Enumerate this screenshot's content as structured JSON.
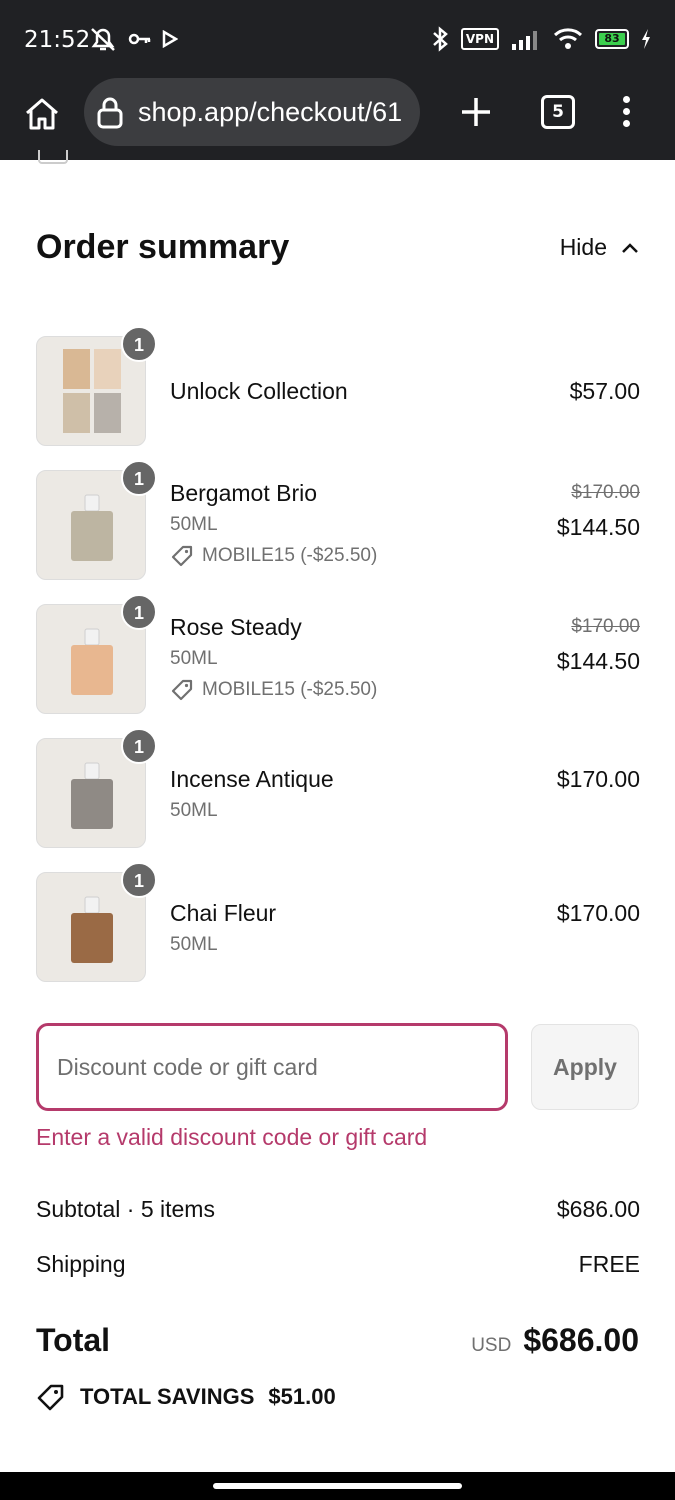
{
  "status_bar": {
    "time": "21:52",
    "vpn": "VPN",
    "battery": "83",
    "battery_color": "#3ccf4e"
  },
  "browser": {
    "url": "shop.app/checkout/61",
    "tab_count": "5"
  },
  "order_summary": {
    "title": "Order summary",
    "toggle_label": "Hide"
  },
  "items": [
    {
      "name": "Unlock Collection",
      "qty": "1",
      "price": "$57.00",
      "thumb_color": "#d8c3a8"
    },
    {
      "name": "Bergamot Brio",
      "qty": "1",
      "variant": "50ML",
      "discount_code": "MOBILE15 (-$25.50)",
      "old_price": "$170.00",
      "price": "$144.50",
      "thumb_color": "#bdb5a2"
    },
    {
      "name": "Rose Steady",
      "qty": "1",
      "variant": "50ML",
      "discount_code": "MOBILE15 (-$25.50)",
      "old_price": "$170.00",
      "price": "$144.50",
      "thumb_color": "#e8b790"
    },
    {
      "name": "Incense Antique",
      "qty": "1",
      "variant": "50ML",
      "price": "$170.00",
      "thumb_color": "#8f8a85"
    },
    {
      "name": "Chai Fleur",
      "qty": "1",
      "variant": "50ML",
      "price": "$170.00",
      "thumb_color": "#9a6a45"
    }
  ],
  "discount": {
    "placeholder": "Discount code or gift card",
    "apply_label": "Apply",
    "error": "Enter a valid discount code or gift card",
    "error_color": "#b53a6b"
  },
  "totals": {
    "subtotal_label": "Subtotal · 5 items",
    "subtotal_value": "$686.00",
    "shipping_label": "Shipping",
    "shipping_value": "FREE",
    "total_label": "Total",
    "currency": "USD",
    "total_value": "$686.00",
    "savings_label": "TOTAL SAVINGS",
    "savings_value": "$51.00"
  }
}
